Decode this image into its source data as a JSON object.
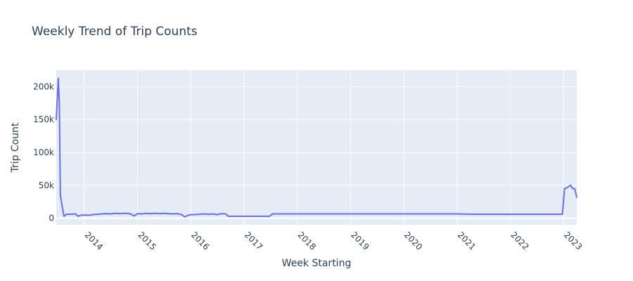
{
  "chart_data": {
    "type": "line",
    "title": "Weekly Trend of Trip Counts",
    "xlabel": "Week Starting",
    "ylabel": "Trip Count",
    "xlim": [
      "2013-06-23",
      "2023-04-02"
    ],
    "ylim": [
      -10000,
      225000
    ],
    "x_ticks": [
      "2014",
      "2015",
      "2016",
      "2017",
      "2018",
      "2019",
      "2020",
      "2021",
      "2022",
      "2023"
    ],
    "y_ticks": [
      {
        "value": 0,
        "label": "0"
      },
      {
        "value": 50000,
        "label": "50k"
      },
      {
        "value": 100000,
        "label": "100k"
      },
      {
        "value": 150000,
        "label": "150k"
      },
      {
        "value": 200000,
        "label": "200k"
      }
    ],
    "grid": true,
    "colors": {
      "line": "#636efa",
      "plot_bg": "#e5ecf6",
      "grid": "#ffffff",
      "text": "#2a3f5f"
    },
    "series": [
      {
        "x": [
          "2013-06-23",
          "2013-06-30",
          "2013-07-07",
          "2013-07-14",
          "2013-07-21",
          "2013-08-01",
          "2013-08-15",
          "2013-09-01",
          "2013-10-01",
          "2013-11-01",
          "2013-11-20",
          "2013-12-10",
          "2014-01-01",
          "2014-02-01",
          "2014-03-01",
          "2014-04-01",
          "2014-05-01",
          "2014-06-01",
          "2014-07-01",
          "2014-08-01",
          "2014-09-01",
          "2014-10-01",
          "2014-11-01",
          "2014-11-20",
          "2014-12-10",
          "2015-01-01",
          "2015-02-01",
          "2015-03-01",
          "2015-04-01",
          "2015-05-01",
          "2015-06-01",
          "2015-07-01",
          "2015-08-01",
          "2015-09-01",
          "2015-10-01",
          "2015-11-01",
          "2015-11-20",
          "2015-12-10",
          "2016-01-01",
          "2016-02-01",
          "2016-03-01",
          "2016-04-01",
          "2016-05-01",
          "2016-06-01",
          "2016-07-01",
          "2016-08-01",
          "2016-08-28",
          "2016-09-15",
          "2017-01-01",
          "2017-06-01",
          "2017-06-25",
          "2017-07-15",
          "2018-01-01",
          "2019-01-01",
          "2020-01-01",
          "2021-01-01",
          "2021-05-01",
          "2022-01-01",
          "2022-12-20",
          "2022-12-25",
          "2023-01-08",
          "2023-01-22",
          "2023-02-05",
          "2023-02-19",
          "2023-03-05",
          "2023-03-19",
          "2023-04-02"
        ],
        "y": [
          150000,
          182000,
          213000,
          175000,
          35000,
          20000,
          3000,
          6000,
          6000,
          6500,
          3000,
          4500,
          5000,
          4500,
          5500,
          6000,
          6500,
          7000,
          6500,
          7500,
          7000,
          7500,
          7200,
          6000,
          3500,
          7000,
          6500,
          7500,
          7000,
          7500,
          7000,
          7500,
          7000,
          6500,
          7000,
          5500,
          2000,
          4000,
          5500,
          5500,
          6000,
          6500,
          6000,
          6500,
          5500,
          7000,
          6500,
          3000,
          3000,
          3000,
          3000,
          6500,
          6500,
          6500,
          6500,
          6500,
          6000,
          6000,
          6000,
          6000,
          45000,
          46000,
          48000,
          50000,
          45000,
          45000,
          32000
        ]
      }
    ]
  }
}
